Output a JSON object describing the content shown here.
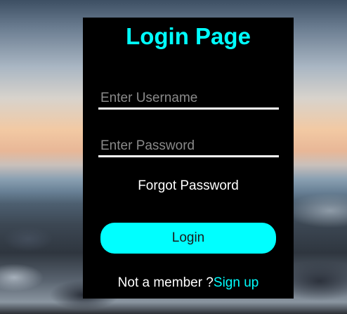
{
  "background": {
    "description_icon": "beach-pebbles-background"
  },
  "login_card": {
    "title": "Login Page",
    "username": {
      "placeholder": "Enter Username",
      "value": ""
    },
    "password": {
      "placeholder": "Enter Password",
      "value": ""
    },
    "forgot_label": "Forgot Password",
    "login_label": "Login",
    "signup_prompt": "Not a member ?",
    "signup_label": "Sign up"
  },
  "colors": {
    "accent": "#00ffff",
    "card_bg": "#000000",
    "text": "#ffffff"
  }
}
